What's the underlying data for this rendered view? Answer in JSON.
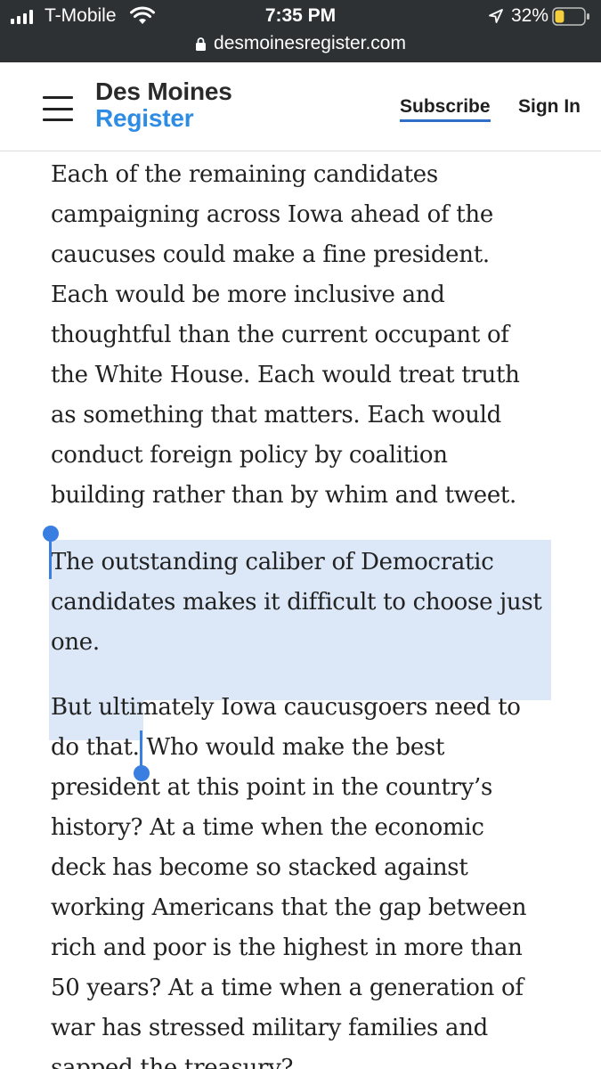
{
  "status_bar": {
    "carrier": "T-Mobile",
    "time": "7:35 PM",
    "battery_percent": "32%",
    "battery_level": 0.32,
    "icons": [
      "signal-icon",
      "wifi-icon",
      "location-arrow-icon",
      "battery-icon"
    ]
  },
  "browser": {
    "url": "desmoinesregister.com",
    "lock_icon": "lock-icon"
  },
  "header": {
    "logo_line1": "Des Moines",
    "logo_line2": "Register",
    "subscribe_label": "Subscribe",
    "signin_label": "Sign In",
    "menu_icon": "hamburger-menu-icon"
  },
  "colors": {
    "status_bar_bg": "#2e3134",
    "logo_accent": "#2f8ce4",
    "subscribe_underline": "#2f6fc9",
    "selection_bg": "#dce8f8",
    "selection_handle": "#3b7ee2",
    "body_text": "#222222"
  },
  "article": {
    "paragraphs": [
      {
        "lines": [
          "Each of the remaining candidates",
          "campaigning across Iowa ahead of the",
          "caucuses could make a fine president.",
          "Each would be more inclusive and",
          "thoughtful than the current occupant of",
          "the White House. Each would treat truth",
          "as something that matters. Each would",
          "conduct foreign policy by coalition",
          "building rather than by whim and tweet."
        ]
      },
      {
        "lines": [
          "The outstanding caliber of Democratic",
          "candidates makes it difficult to choose just",
          "one."
        ]
      },
      {
        "lines": [
          "But ultimately Iowa caucusgoers need to",
          "do that. Who would make the best",
          "president at this point in the country’s",
          "history? At a time when the economic",
          "deck has become so stacked against",
          "working Americans that the gap between",
          "rich and poor is the highest in more than",
          "50 years? At a time when a generation of",
          "war has stressed military families and",
          "sapped the treasury?"
        ]
      }
    ]
  }
}
